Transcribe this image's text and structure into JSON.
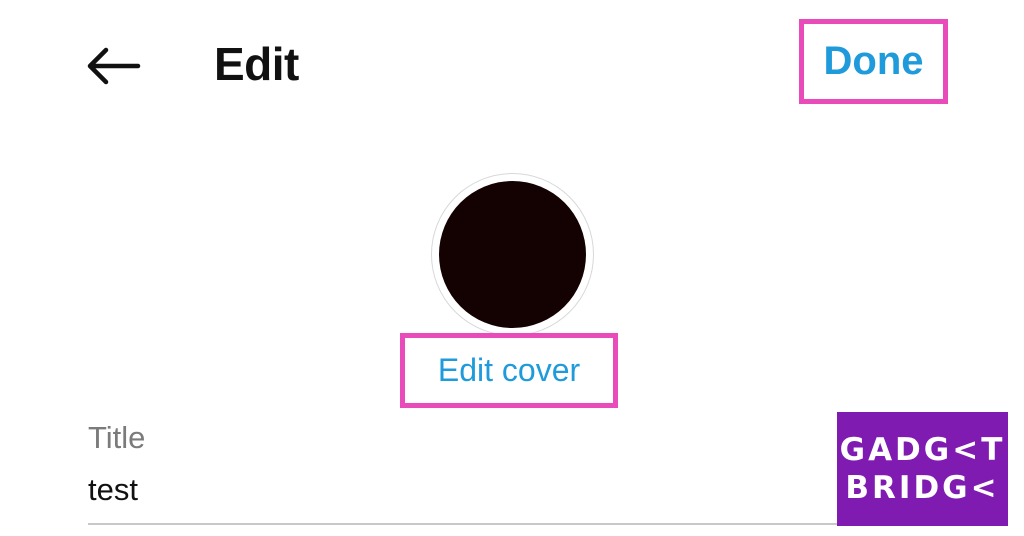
{
  "header": {
    "title": "Edit",
    "done_label": "Done",
    "back_icon": "arrow-left-icon"
  },
  "cover": {
    "edit_label": "Edit cover",
    "image_color": "#140101"
  },
  "form": {
    "title_label": "Title",
    "title_value": "test"
  },
  "watermark": {
    "line1": "GADG<T",
    "line2": "BRIDG<"
  },
  "colors": {
    "accent": "#1f9bdb",
    "highlight": "#e94bbb",
    "watermark_bg": "#7f1bb1"
  }
}
